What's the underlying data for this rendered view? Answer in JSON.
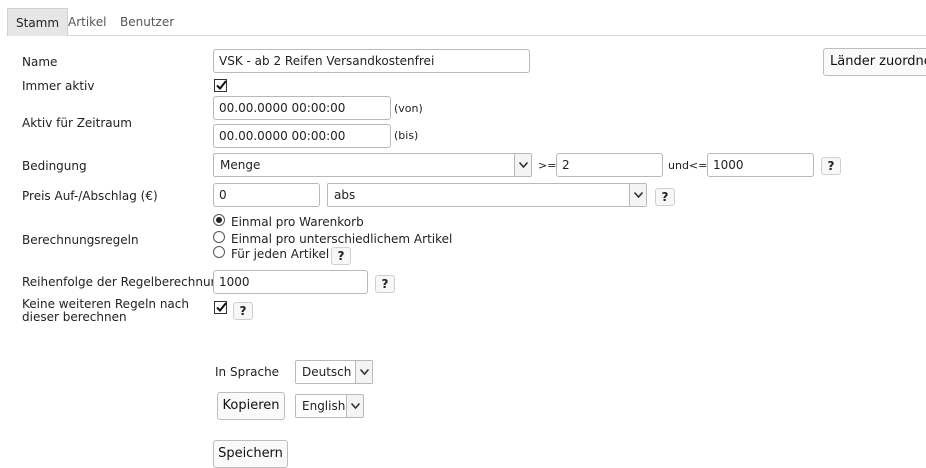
{
  "tabs": [
    "Stamm",
    "Artikel",
    "Benutzer"
  ],
  "form": {
    "name_label": "Name",
    "name_value": "VSK - ab 2 Reifen Versandkostenfrei",
    "countries_button": "Länder zuordnen",
    "always_active_label": "Immer aktiv",
    "always_active_checked": true,
    "period_label": "Aktiv für Zeitraum",
    "from_value": "00.00.0000 00:00:00",
    "from_suffix": "(von)",
    "to_value": "00.00.0000 00:00:00",
    "to_suffix": "(bis)",
    "condition_label": "Bedingung",
    "condition_value": "Menge",
    "gte_label": ">=",
    "gte_value": "2",
    "lte_label": "und<=",
    "lte_value": "1000",
    "price_label": "Preis Auf-/Abschlag (€)",
    "price_value": "0",
    "price_type": "abs",
    "calc_rules_label": "Berechnungsregeln",
    "calc_rule_options": [
      "Einmal pro Warenkorb",
      "Einmal pro unterschiedlichem Artikel",
      "Für jeden Artikel"
    ],
    "calc_rule_selected": "Einmal pro Warenkorb",
    "order_label": "Reihenfolge der Regelberechnung",
    "order_value": "1000",
    "no_further_label_line1": "Keine weiteren Regeln nach",
    "no_further_label_line2": "dieser berechnen",
    "no_further_checked": true,
    "help_glyph": "?"
  },
  "language": {
    "label": "In Sprache",
    "selected": "Deutsch",
    "copy_button": "Kopieren",
    "target_language": "English"
  },
  "save_button": "Speichern",
  "icons": {
    "dropdown": "chevron-down-icon",
    "help": "help-icon",
    "checkbox": "checkmark-icon"
  }
}
